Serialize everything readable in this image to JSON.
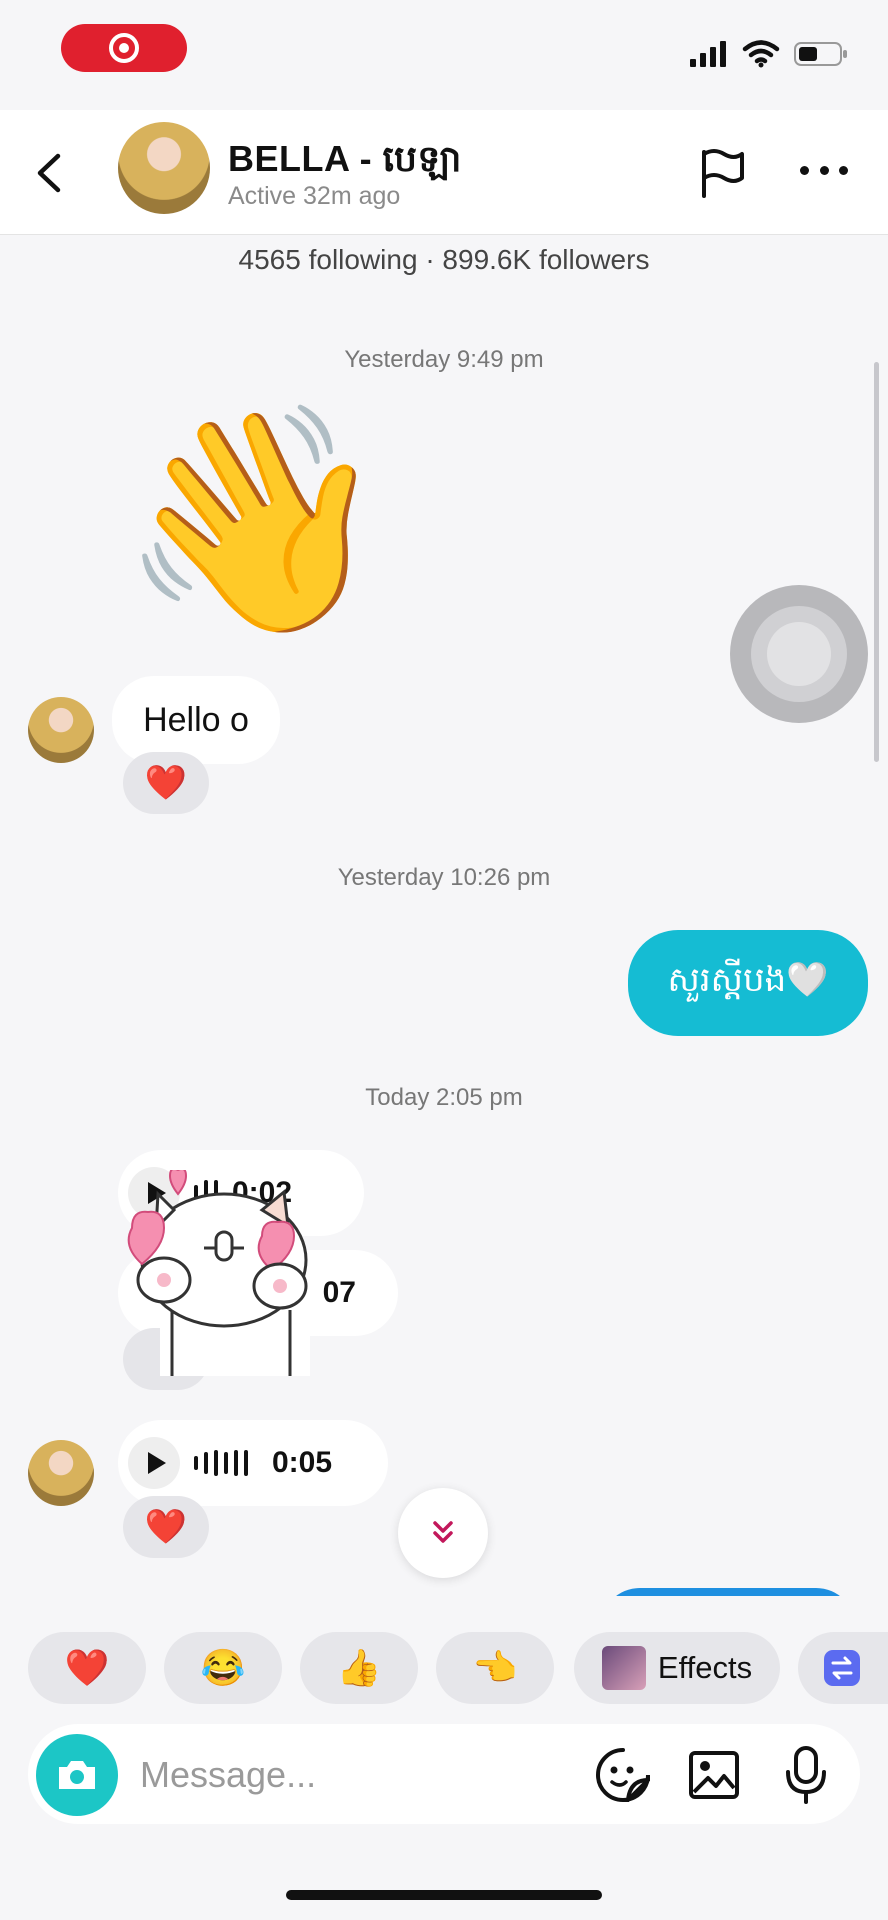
{
  "header": {
    "name": "BELLA - បេឡា",
    "status": "Active 32m ago"
  },
  "profile_stats": "4565 following · 899.6K followers",
  "timestamps": [
    "Yesterday 9:49 pm",
    "Yesterday 10:26 pm",
    "Today 2:05 pm"
  ],
  "messages": {
    "wave_emoji": "👋",
    "hello_text": "Hello o",
    "hello_reaction": "❤️",
    "outgoing_text": "សួរស្តីបង🤍",
    "voice1_duration": "0:02",
    "voice2_duration": "07",
    "voice3_duration": "0:05",
    "voice3_reaction": "❤️"
  },
  "quick_reactions": [
    "❤️",
    "😂",
    "👍",
    "👈"
  ],
  "effects_label": "Effects",
  "composer": {
    "placeholder": "Message..."
  },
  "colors": {
    "accent": "#15bcd3",
    "record": "#e0202e",
    "camera": "#1cc6c6"
  }
}
